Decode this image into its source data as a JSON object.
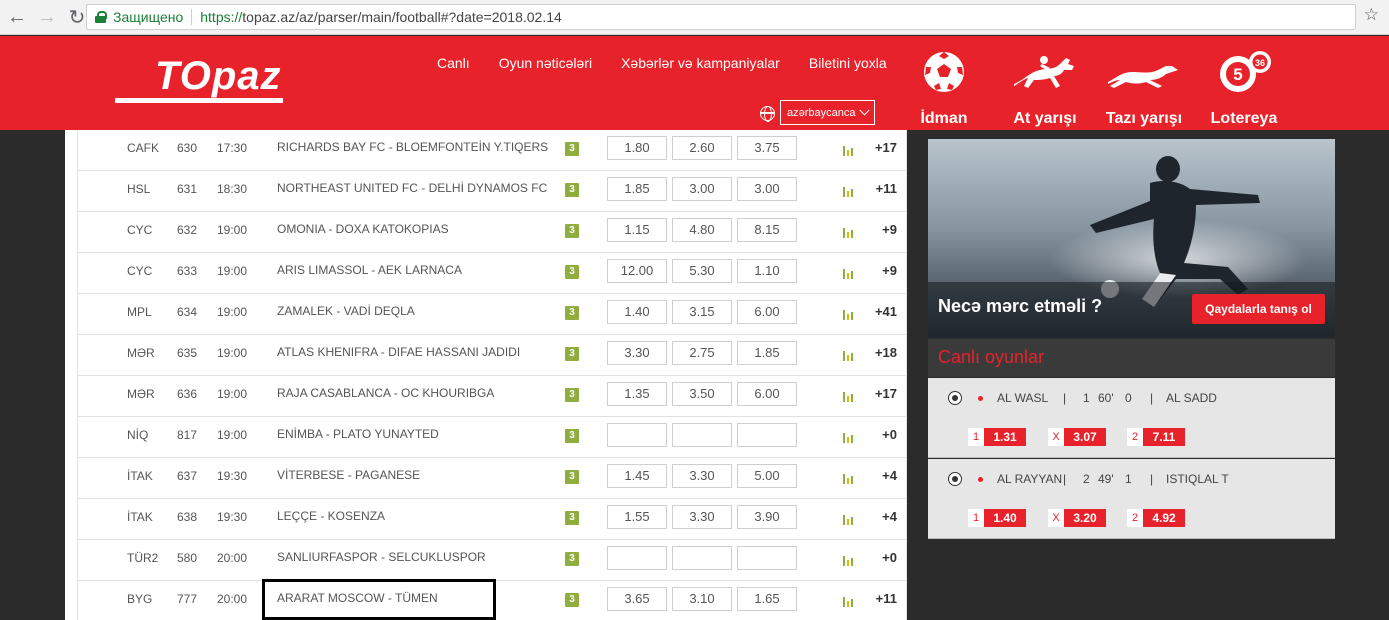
{
  "browser": {
    "secure_label": "Защищено",
    "url_scheme": "https://",
    "url_rest": "topaz.az/az/parser/main/football#?date=2018.02.14"
  },
  "header": {
    "logo_text": "TOpaz",
    "nav": [
      "Canlı",
      "Oyun nəticələri",
      "Xəbərlər və kampaniyalar",
      "Biletini yoxla"
    ],
    "language": "azərbaycanca",
    "categories": {
      "sport": "İdman",
      "horse": "At yarışı",
      "dog": "Tazı yarışı",
      "lottery": "Lotereya"
    },
    "lotto_ball_1": "5",
    "lotto_ball_2": "36"
  },
  "matches": [
    {
      "league": "CAFK",
      "code": "630",
      "time": "17:30",
      "match": "RICHARDS BAY FC - BLOEMFONTEİN Y.TIQERS",
      "badge": "3",
      "o1": "1.80",
      "ox": "2.60",
      "o2": "3.75",
      "more": "+17"
    },
    {
      "league": "HSL",
      "code": "631",
      "time": "18:30",
      "match": "NORTHEAST UNITED FC - DELHİ DYNAMOS FC",
      "badge": "3",
      "o1": "1.85",
      "ox": "3.00",
      "o2": "3.00",
      "more": "+11"
    },
    {
      "league": "CYC",
      "code": "632",
      "time": "19:00",
      "match": "OMONIA - DOXA KATOKOPIAS",
      "badge": "3",
      "o1": "1.15",
      "ox": "4.80",
      "o2": "8.15",
      "more": "+9"
    },
    {
      "league": "CYC",
      "code": "633",
      "time": "19:00",
      "match": "ARIS LIMASSOL - AEK LARNACA",
      "badge": "3",
      "o1": "12.00",
      "ox": "5.30",
      "o2": "1.10",
      "more": "+9"
    },
    {
      "league": "MPL",
      "code": "634",
      "time": "19:00",
      "match": "ZAMALEK - VADİ DEQLA",
      "badge": "3",
      "o1": "1.40",
      "ox": "3.15",
      "o2": "6.00",
      "more": "+41"
    },
    {
      "league": "MƏR",
      "code": "635",
      "time": "19:00",
      "match": "ATLAS KHENIFRA - DIFAE HASSANI JADIDI",
      "badge": "3",
      "o1": "3.30",
      "ox": "2.75",
      "o2": "1.85",
      "more": "+18"
    },
    {
      "league": "MƏR",
      "code": "636",
      "time": "19:00",
      "match": "RAJA CASABLANCA - OC KHOURIBGA",
      "badge": "3",
      "o1": "1.35",
      "ox": "3.50",
      "o2": "6.00",
      "more": "+17"
    },
    {
      "league": "NİQ",
      "code": "817",
      "time": "19:00",
      "match": "ENİMBA - PLATO YUNAYTED",
      "badge": "3",
      "o1": "",
      "ox": "",
      "o2": "",
      "more": "+0"
    },
    {
      "league": "İTAK",
      "code": "637",
      "time": "19:30",
      "match": "VİTERBESE - PAGANESE",
      "badge": "3",
      "o1": "1.45",
      "ox": "3.30",
      "o2": "5.00",
      "more": "+4"
    },
    {
      "league": "İTAK",
      "code": "638",
      "time": "19:30",
      "match": "LEÇÇE - KOSENZA",
      "badge": "3",
      "o1": "1.55",
      "ox": "3.30",
      "o2": "3.90",
      "more": "+4"
    },
    {
      "league": "TÜR2",
      "code": "580",
      "time": "20:00",
      "match": "SANLIURFASPOR - SELCUKLUSPOR",
      "badge": "3",
      "o1": "",
      "ox": "",
      "o2": "",
      "more": "+0"
    },
    {
      "league": "BYG",
      "code": "777",
      "time": "20:00",
      "match": "ARARAT MOSCOW - TÜMEN",
      "badge": "3",
      "o1": "3.65",
      "ox": "3.10",
      "o2": "1.65",
      "more": "+11"
    }
  ],
  "promo": {
    "title": "Necə mərc etməli ?",
    "button": "Qaydalarla tanış ol"
  },
  "live": {
    "title": "Canlı oyunlar",
    "games": [
      {
        "team1": "AL WASL",
        "sep": "|",
        "score1": "1",
        "minute": "60'",
        "score2": "0",
        "team2": "AL SADD",
        "l1": "1",
        "v1": "1.31",
        "lx": "X",
        "vx": "3.07",
        "l2": "2",
        "v2": "7.11"
      },
      {
        "team1": "AL RAYYAN",
        "sep": "|",
        "score1": "2",
        "minute": "49'",
        "score2": "1",
        "team2": "ISTIQLAL T",
        "l1": "1",
        "v1": "1.40",
        "lx": "X",
        "vx": "3.20",
        "l2": "2",
        "v2": "4.92"
      }
    ]
  },
  "colors": {
    "brand_red": "#e8222a",
    "badge_green": "#8fae3f"
  }
}
